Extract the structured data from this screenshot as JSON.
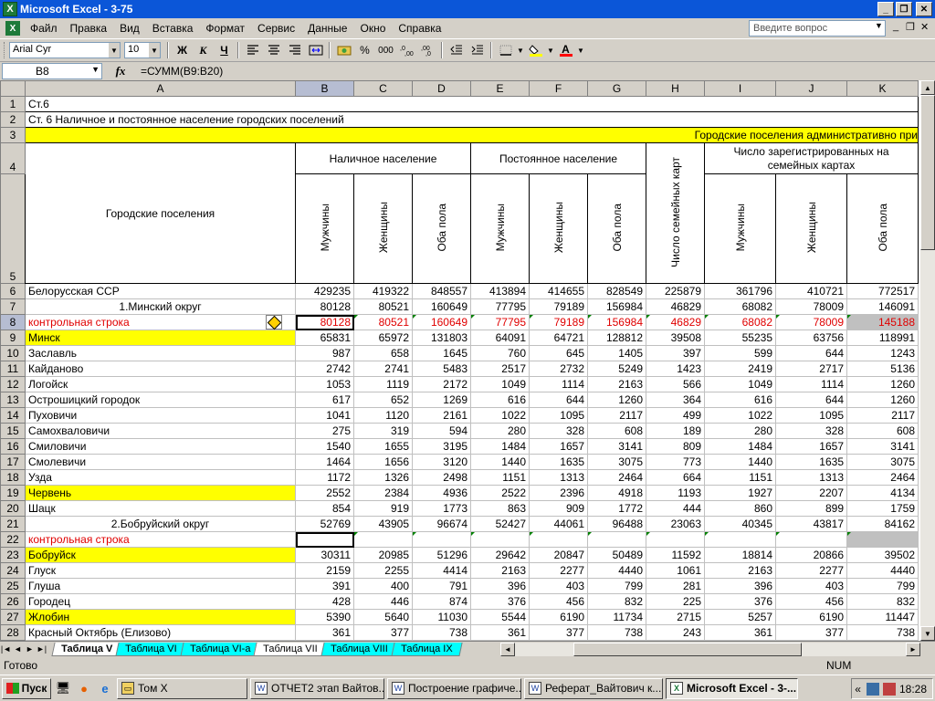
{
  "window": {
    "title": "Microsoft Excel - 3-75"
  },
  "menu": {
    "items": [
      "Файл",
      "Правка",
      "Вид",
      "Вставка",
      "Формат",
      "Сервис",
      "Данные",
      "Окно",
      "Справка"
    ],
    "help_placeholder": "Введите вопрос"
  },
  "toolbar": {
    "font_name": "Arial Cyr",
    "font_size": "10",
    "bold": "Ж",
    "italic": "К",
    "underline": "Ч",
    "percent": "%",
    "thousands": "000",
    "font_color_label": "A"
  },
  "formula_bar": {
    "cell_ref": "B8",
    "fx": "fx",
    "formula": "=СУММ(B9:B20)"
  },
  "grid": {
    "columns": [
      "A",
      "B",
      "C",
      "D",
      "E",
      "F",
      "G",
      "H",
      "I",
      "J",
      "K"
    ],
    "row1": "Ст.6",
    "row2": "Ст. 6 Наличное и постоянное население городских поселений",
    "row3": "Городские поселения административно при",
    "hdr_settlements": "Городские поселения",
    "hdr_nalich": "Наличное население",
    "hdr_postoyan": "Постоянное население",
    "hdr_family_cards": "Число семейных карт",
    "hdr_registered": "Число зарегистрированных на семейных картах",
    "hdr_men": "Мужчины",
    "hdr_women": "Женщины",
    "hdr_both": "Оба пола",
    "data_rows": [
      {
        "n": "6",
        "name": "Белорусская ССР",
        "style": "normal",
        "v": [
          "429235",
          "419322",
          "848557",
          "413894",
          "414655",
          "828549",
          "225879",
          "361796",
          "410721",
          "772517"
        ]
      },
      {
        "n": "7",
        "name": "1.Минский округ",
        "style": "center",
        "v": [
          "80128",
          "80521",
          "160649",
          "77795",
          "79189",
          "156984",
          "46829",
          "68082",
          "78009",
          "146091"
        ]
      },
      {
        "n": "8",
        "name": "контрольная строка",
        "style": "red",
        "v": [
          "80128",
          "80521",
          "160649",
          "77795",
          "79189",
          "156984",
          "46829",
          "68082",
          "78009",
          "145188"
        ]
      },
      {
        "n": "9",
        "name": "Минск",
        "style": "yellow",
        "v": [
          "65831",
          "65972",
          "131803",
          "64091",
          "64721",
          "128812",
          "39508",
          "55235",
          "63756",
          "118991"
        ]
      },
      {
        "n": "10",
        "name": "Заславль",
        "style": "normal",
        "v": [
          "987",
          "658",
          "1645",
          "760",
          "645",
          "1405",
          "397",
          "599",
          "644",
          "1243"
        ]
      },
      {
        "n": "11",
        "name": "Кайданово",
        "style": "normal",
        "v": [
          "2742",
          "2741",
          "5483",
          "2517",
          "2732",
          "5249",
          "1423",
          "2419",
          "2717",
          "5136"
        ]
      },
      {
        "n": "12",
        "name": "Логойск",
        "style": "normal",
        "v": [
          "1053",
          "1119",
          "2172",
          "1049",
          "1114",
          "2163",
          "566",
          "1049",
          "1114",
          "1260"
        ]
      },
      {
        "n": "13",
        "name": "Острошицкий городок",
        "style": "normal",
        "v": [
          "617",
          "652",
          "1269",
          "616",
          "644",
          "1260",
          "364",
          "616",
          "644",
          "1260"
        ]
      },
      {
        "n": "14",
        "name": "Пуховичи",
        "style": "normal",
        "v": [
          "1041",
          "1120",
          "2161",
          "1022",
          "1095",
          "2117",
          "499",
          "1022",
          "1095",
          "2117"
        ]
      },
      {
        "n": "15",
        "name": "Самохваловичи",
        "style": "normal",
        "v": [
          "275",
          "319",
          "594",
          "280",
          "328",
          "608",
          "189",
          "280",
          "328",
          "608"
        ]
      },
      {
        "n": "16",
        "name": "Смиловичи",
        "style": "normal",
        "v": [
          "1540",
          "1655",
          "3195",
          "1484",
          "1657",
          "3141",
          "809",
          "1484",
          "1657",
          "3141"
        ]
      },
      {
        "n": "17",
        "name": "Смолевичи",
        "style": "normal",
        "v": [
          "1464",
          "1656",
          "3120",
          "1440",
          "1635",
          "3075",
          "773",
          "1440",
          "1635",
          "3075"
        ]
      },
      {
        "n": "18",
        "name": "Узда",
        "style": "normal",
        "v": [
          "1172",
          "1326",
          "2498",
          "1151",
          "1313",
          "2464",
          "664",
          "1151",
          "1313",
          "2464"
        ]
      },
      {
        "n": "19",
        "name": "Червень",
        "style": "yellow",
        "v": [
          "2552",
          "2384",
          "4936",
          "2522",
          "2396",
          "4918",
          "1193",
          "1927",
          "2207",
          "4134"
        ]
      },
      {
        "n": "20",
        "name": "Шацк",
        "style": "normal",
        "v": [
          "854",
          "919",
          "1773",
          "863",
          "909",
          "1772",
          "444",
          "860",
          "899",
          "1759"
        ]
      },
      {
        "n": "21",
        "name": "2.Бобруйский округ",
        "style": "center",
        "v": [
          "52769",
          "43905",
          "96674",
          "52427",
          "44061",
          "96488",
          "23063",
          "40345",
          "43817",
          "84162"
        ]
      },
      {
        "n": "22",
        "name": "контрольная строка",
        "style": "red",
        "v": [
          "",
          "",
          "",
          "",
          "",
          "",
          "",
          "",
          "",
          ""
        ]
      },
      {
        "n": "23",
        "name": "Бобруйск",
        "style": "yellow",
        "v": [
          "30311",
          "20985",
          "51296",
          "29642",
          "20847",
          "50489",
          "11592",
          "18814",
          "20866",
          "39502"
        ]
      },
      {
        "n": "24",
        "name": "Глуск",
        "style": "normal",
        "v": [
          "2159",
          "2255",
          "4414",
          "2163",
          "2277",
          "4440",
          "1061",
          "2163",
          "2277",
          "4440"
        ]
      },
      {
        "n": "25",
        "name": "Глуша",
        "style": "normal",
        "v": [
          "391",
          "400",
          "791",
          "396",
          "403",
          "799",
          "281",
          "396",
          "403",
          "799"
        ]
      },
      {
        "n": "26",
        "name": "Городец",
        "style": "normal",
        "v": [
          "428",
          "446",
          "874",
          "376",
          "456",
          "832",
          "225",
          "376",
          "456",
          "832"
        ]
      },
      {
        "n": "27",
        "name": "Жлобин",
        "style": "yellow",
        "v": [
          "5390",
          "5640",
          "11030",
          "5544",
          "6190",
          "11734",
          "2715",
          "5257",
          "6190",
          "11447"
        ]
      },
      {
        "n": "28",
        "name": "Красный Октябрь (Елизово)",
        "style": "normal",
        "v": [
          "361",
          "377",
          "738",
          "361",
          "377",
          "738",
          "243",
          "361",
          "377",
          "738"
        ]
      }
    ]
  },
  "sheet_tabs": [
    {
      "label": "Таблица V",
      "kind": "active"
    },
    {
      "label": "Таблица VI",
      "kind": "cyan"
    },
    {
      "label": "Таблица VI-а",
      "kind": "cyan"
    },
    {
      "label": "Таблица VII",
      "kind": "plain"
    },
    {
      "label": "Таблица VIII",
      "kind": "cyan"
    },
    {
      "label": "Таблица IX",
      "kind": "cyan"
    }
  ],
  "status": {
    "ready": "Готово",
    "num": "NUM"
  },
  "taskbar": {
    "start": "Пуск",
    "tasks": [
      "Том X",
      "ОТЧЕТ2 этап Вайтов...",
      "Построение графиче...",
      "Реферат_Вайтович к...",
      "Microsoft Excel - 3-..."
    ],
    "clock": "18:28"
  }
}
